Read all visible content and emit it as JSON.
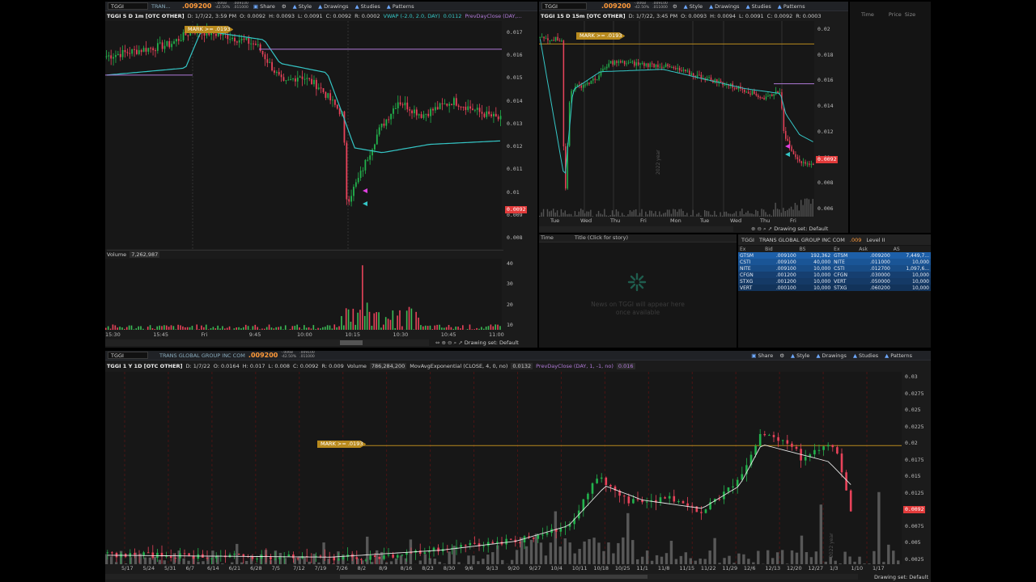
{
  "colors": {
    "up": "#22b24c",
    "down": "#e8435a",
    "vwap": "#35c6c6",
    "prevclose": "#b07ad8",
    "mark": "#b88a1e",
    "volume": "#5a5a5a",
    "volume_up": "#3cbb56",
    "volume_down": "#e8435a"
  },
  "tl": {
    "symbol": "TGGI",
    "company": "TRAN...",
    "price": ".009200",
    "change_top": "-.0068",
    "change_bot": "-42.50%",
    "bid": ".009100",
    "ask": ".011000",
    "buttons": {
      "share": "Share",
      "style": "Style",
      "drawings": "Drawings",
      "studies": "Studies",
      "patterns": "Patterns"
    },
    "info": {
      "title": "TGGI 5 D 1m [OTC OTHER]",
      "d": "D: 1/7/22, 3:59 PM",
      "o": "O: 0.0092",
      "h": "H: 0.0093",
      "l": "L: 0.0091",
      "c": "C: 0.0092",
      "r": "R: 0.0002",
      "vwap": "VWAP (-2.0, 2.0, DAY)",
      "vwap_val": "0.0112",
      "prev": "PrevDayClose (DAY,..."
    },
    "mark": "MARK >= .0193",
    "yticks": [
      "0.017",
      "0.016",
      "0.015",
      "0.014",
      "0.013",
      "0.012",
      "0.011",
      "0.01",
      "0.009",
      "0.008"
    ],
    "last": "0.0092",
    "volume_label": "Volume",
    "volume_val": "7,262,987",
    "vyticks": [
      "40",
      "30",
      "20",
      "10"
    ],
    "xticks": [
      "15:30",
      "15:45",
      "Fri",
      "9:45",
      "10:00",
      "10:15",
      "10:30",
      "10:45",
      "11:00"
    ],
    "drawing_set": "Drawing set: Default"
  },
  "tr": {
    "symbol": "TGGI",
    "price": ".009200",
    "change_top": "-.0068",
    "change_bot": "-42.50%",
    "bid": ".009100",
    "ask": ".011000",
    "buttons": {
      "style": "Style",
      "drawings": "Drawings",
      "studies": "Studies",
      "patterns": "Patterns"
    },
    "info": {
      "title": "TGGI 15 D 15m [OTC OTHER]",
      "d": "D: 1/7/22, 3:45 PM",
      "o": "O: 0.0093",
      "h": "H: 0.0094",
      "l": "L: 0.0091",
      "c": "C: 0.0092",
      "r": "R: 0.0003"
    },
    "mark": "MARK >= .0193",
    "yticks": [
      "0.02",
      "0.018",
      "0.016",
      "0.014",
      "0.012",
      "0.01",
      "0.008",
      "0.006"
    ],
    "last": "0.0092",
    "xticks": [
      "Tue",
      "Wed",
      "Thu",
      "Fri",
      "Mon",
      "Tue",
      "Wed",
      "Thu",
      "Fri"
    ],
    "year": "2022 year",
    "drawing_set": "Drawing set: Default"
  },
  "ts": {
    "time": "Time",
    "price": "Price",
    "size": "Size"
  },
  "news": {
    "time": "Time",
    "title": "Title (Click for story)",
    "empty1": "News on TGGI will appear here",
    "empty2": "once available"
  },
  "l2": {
    "symbol": "TGGI",
    "company": "TRANS GLOBAL GROUP INC COM",
    "price": ".009",
    "level": "Level II",
    "headers": [
      "Ex",
      "Bid",
      "BS",
      "Ex",
      "Ask",
      "AS"
    ],
    "rows": [
      [
        "GTSM",
        ".009100",
        "192,362",
        "GTSM",
        ".009200",
        "7,449,7..."
      ],
      [
        "CSTI",
        ".009100",
        "40,000",
        "NITE",
        ".011000",
        "10,000"
      ],
      [
        "NITE",
        ".009100",
        "10,000",
        "CSTI",
        ".012700",
        "1,097,6..."
      ],
      [
        "CFGN",
        ".001200",
        "10,000",
        "CFGN",
        ".030000",
        "10,000"
      ],
      [
        "STXG",
        ".001200",
        "10,000",
        "VERT",
        ".050000",
        "10,000"
      ],
      [
        "VERT",
        ".000100",
        "10,000",
        "STXG",
        ".060200",
        "10,000"
      ]
    ]
  },
  "bot": {
    "symbol": "TGGI",
    "company": "TRANS GLOBAL GROUP INC COM",
    "price": ".009200",
    "change_top": "-.0068",
    "change_bot": "-42.50%",
    "bid": ".009100",
    "ask": ".011000",
    "buttons": {
      "share": "Share",
      "style": "Style",
      "drawings": "Drawings",
      "studies": "Studies",
      "patterns": "Patterns"
    },
    "info": {
      "title": "TGGI 1 Y 1D [OTC OTHER]",
      "d": "D: 1/7/22",
      "o": "O: 0.0164",
      "h": "H: 0.017",
      "l": "L: 0.008",
      "c": "C: 0.0092",
      "r": "R: 0.009",
      "vol": "Volume",
      "vol_val": "786,284,200",
      "ema": "MovAvgExponential (CLOSE, 4, 0, no)",
      "ema_val": "0.0132",
      "prev": "PrevDayClose (DAY, 1, -1, no)",
      "prev_val": "0.016"
    },
    "mark": "MARK >= .0193",
    "yticks": [
      "0.03",
      "0.0275",
      "0.025",
      "0.0225",
      "0.02",
      "0.0175",
      "0.015",
      "0.0125",
      "0.01",
      "0.0075",
      "0.005",
      "0.0025"
    ],
    "last": "0.0092",
    "xticks": [
      "5/17",
      "5/24",
      "5/31",
      "6/7",
      "6/14",
      "6/21",
      "6/28",
      "7/5",
      "7/12",
      "7/19",
      "7/26",
      "8/2",
      "8/9",
      "8/16",
      "8/23",
      "8/30",
      "9/6",
      "9/13",
      "9/20",
      "9/27",
      "10/4",
      "10/11",
      "10/18",
      "10/25",
      "11/1",
      "11/8",
      "11/15",
      "11/22",
      "11/29",
      "12/6",
      "12/13",
      "12/20",
      "12/27",
      "1/3",
      "1/10",
      "1/17"
    ],
    "year": "2022 year",
    "drawing_set": "Drawing set: Default"
  }
}
